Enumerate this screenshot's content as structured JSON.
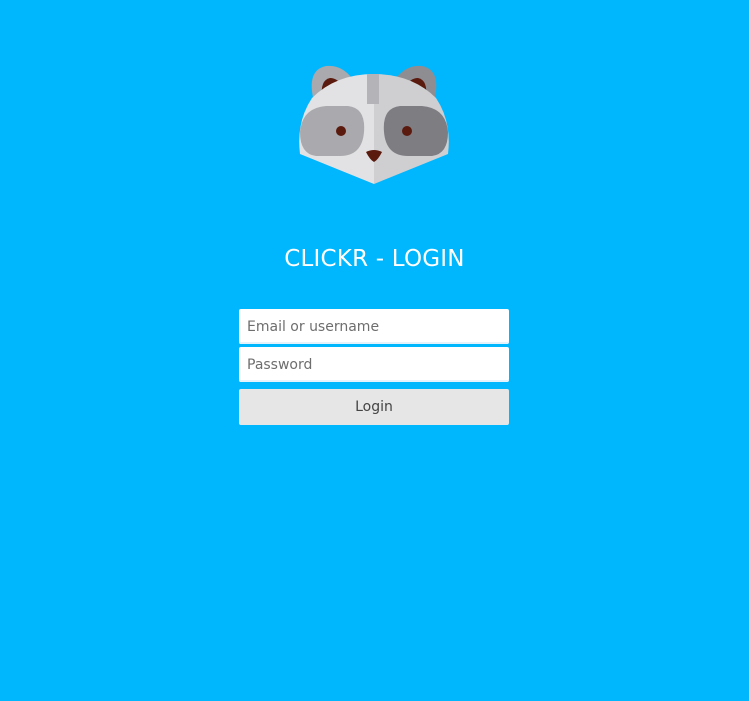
{
  "app": {
    "title": "CLICKR - LOGIN",
    "logo_icon": "raccoon-icon",
    "background_color": "#00b7fd"
  },
  "login_form": {
    "email_field": {
      "value": "",
      "placeholder": "Email or username"
    },
    "password_field": {
      "value": "",
      "placeholder": "Password"
    },
    "submit_label": "Login"
  }
}
